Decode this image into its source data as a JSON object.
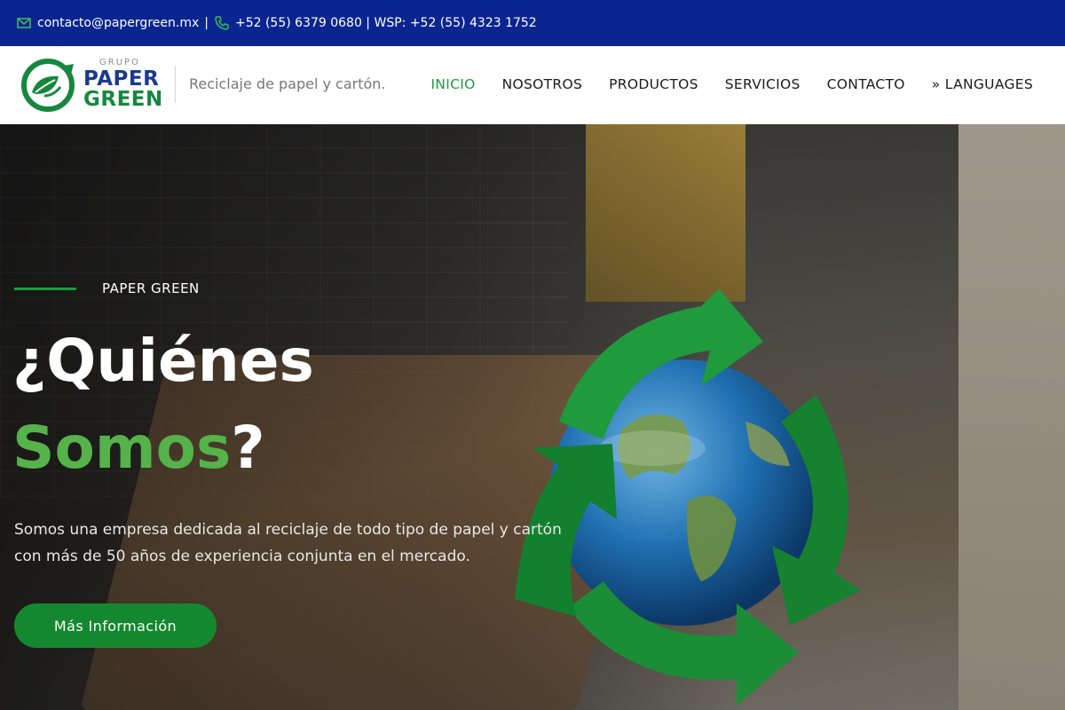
{
  "topbar": {
    "email": "contacto@papergreen.mx",
    "separator": "|",
    "phone": "+52 (55) 6379 0680 | WSP: +52 (55) 4323 1752"
  },
  "header": {
    "logo": {
      "grupo": "GRUPO",
      "paper": "PAPER",
      "green": "GREEN"
    },
    "tagline": "Reciclaje de papel y cartón.",
    "nav": [
      {
        "label": "INICIO",
        "active": true
      },
      {
        "label": "NOSOTROS",
        "active": false
      },
      {
        "label": "PRODUCTOS",
        "active": false
      },
      {
        "label": "SERVICIOS",
        "active": false
      },
      {
        "label": "CONTACTO",
        "active": false
      },
      {
        "label": "» LANGUAGES",
        "active": false
      }
    ]
  },
  "hero": {
    "eyebrow": "PAPER GREEN",
    "title_line1": "¿Quiénes",
    "title_green": "Somos",
    "title_end": "?",
    "description": "Somos una empresa dedicada al reciclaje de todo tipo de papel y cartón con más de 50 años de experiencia conjunta en el mercado.",
    "button": "Más Información"
  },
  "colors": {
    "topbar": "#0b2590",
    "brand_green": "#1e9b3d",
    "brand_blue": "#1a3a8f",
    "button": "#13882f",
    "title_green": "#56b24a"
  },
  "icons": [
    "mail-icon",
    "phone-icon",
    "logo-leaf-icon",
    "recycle-globe-graphic"
  ]
}
